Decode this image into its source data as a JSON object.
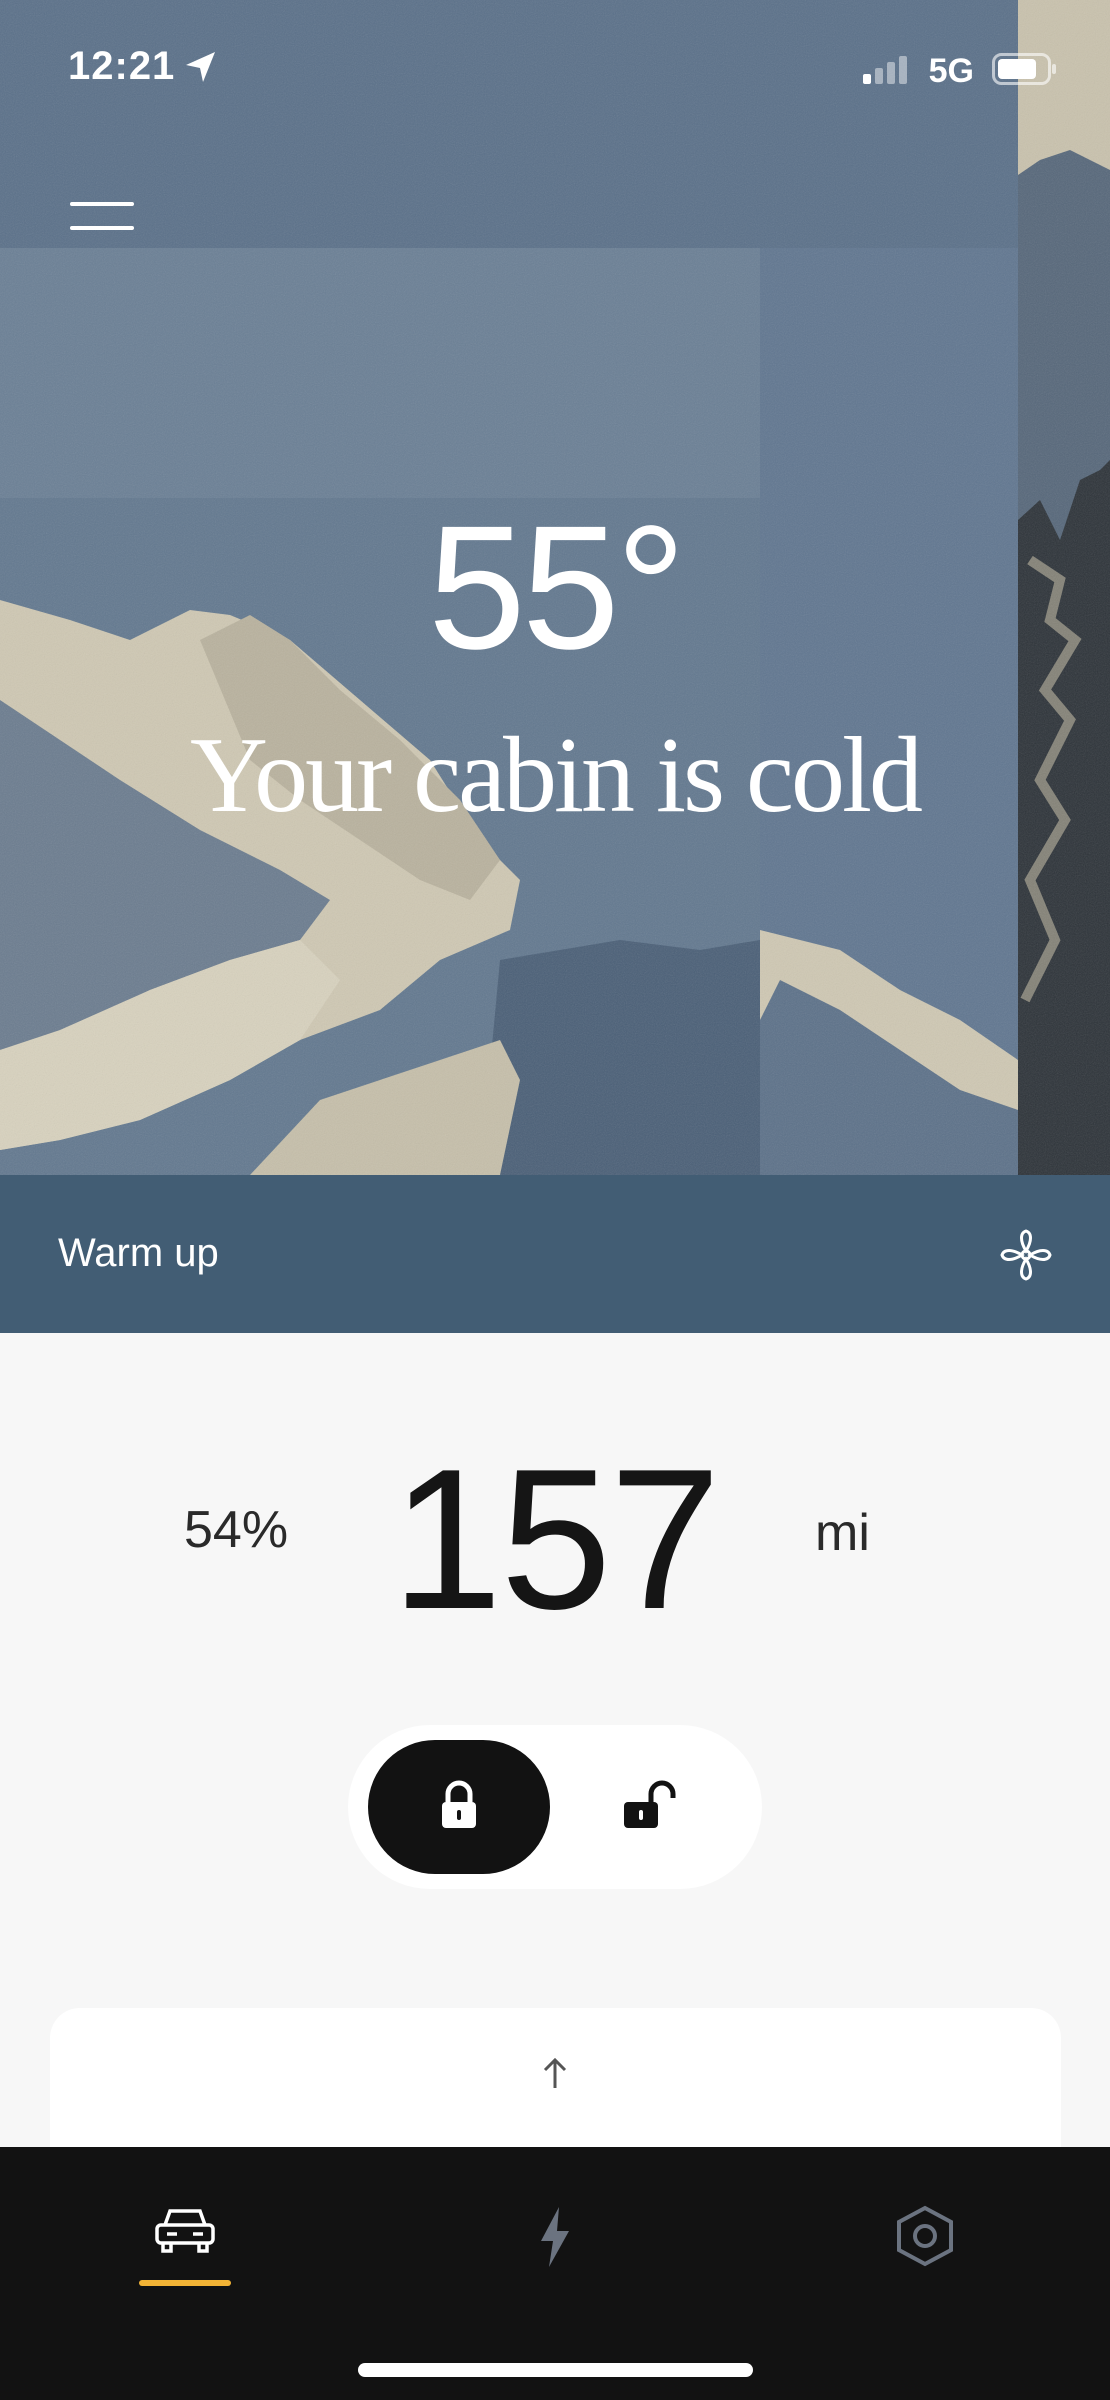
{
  "status_bar": {
    "time": "12:21",
    "network": "5G",
    "icons": [
      "location-arrow-icon",
      "signal-icon",
      "battery-icon"
    ]
  },
  "hero": {
    "temperature": "55°",
    "message": "Your cabin is cold",
    "menu_icon": "hamburger-menu-icon"
  },
  "climate": {
    "label": "Warm up",
    "icon": "fan-icon",
    "color": "#425d74"
  },
  "range": {
    "battery_percent": "54%",
    "value": "157",
    "unit": "mi"
  },
  "lock_toggle": {
    "active": "locked",
    "locked_icon": "lock-closed-icon",
    "unlocked_icon": "lock-open-icon"
  },
  "card": {
    "icon": "arrow-up-icon"
  },
  "tab_bar": {
    "tabs": [
      {
        "name": "vehicle",
        "icon": "car-icon",
        "active": true
      },
      {
        "name": "charging",
        "icon": "lightning-icon",
        "active": false
      },
      {
        "name": "settings",
        "icon": "hexagon-icon",
        "active": false
      }
    ],
    "accent": "#f2b335"
  }
}
